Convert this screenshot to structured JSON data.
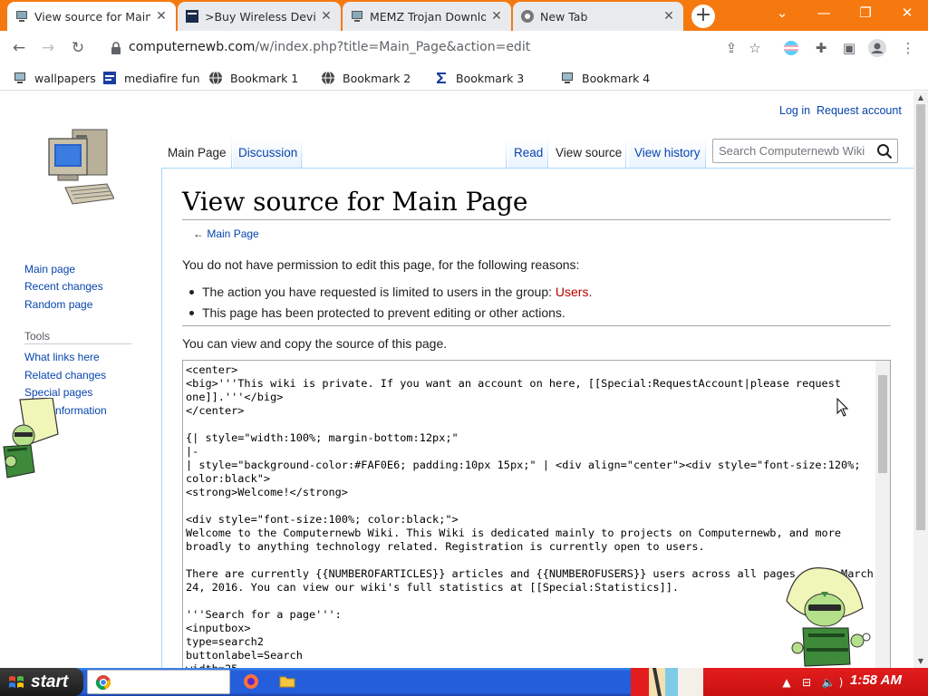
{
  "browser": {
    "tabs": [
      {
        "title": "View source for Main",
        "favicon": "computer-favicon",
        "active": true
      },
      {
        "title": ">Buy Wireless Device",
        "favicon": "site-favicon",
        "active": false
      },
      {
        "title": "MEMZ Trojan Downlo",
        "favicon": "computer-favicon",
        "active": false
      },
      {
        "title": "New Tab",
        "favicon": "chrome-favicon",
        "active": false
      }
    ],
    "new_tab_symbol": "+",
    "url_host": "computernewb.com",
    "url_path": "/w/index.php?title=Main_Page&action=edit",
    "bookmarks": [
      {
        "label": "wallpapers",
        "icon": "computer-icon"
      },
      {
        "label": "mediafire fun",
        "icon": "mediafire-icon"
      },
      {
        "label": "Bookmark 1",
        "icon": "globe-icon"
      },
      {
        "label": "Bookmark 2",
        "icon": "globe-icon"
      },
      {
        "label": "Bookmark 3",
        "icon": "sigma-icon"
      },
      {
        "label": "Bookmark 4",
        "icon": "computer-icon"
      }
    ],
    "accent_color": "#f5790f"
  },
  "page": {
    "personal": {
      "login": "Log in",
      "request": "Request account"
    },
    "tabs": {
      "main_page": "Main Page",
      "discussion": "Discussion",
      "read": "Read",
      "view_source": "View source",
      "view_history": "View history"
    },
    "search_placeholder": "Search Computernewb Wiki",
    "sidebar": {
      "nav": [
        "Main page",
        "Recent changes",
        "Random page"
      ],
      "tools_heading": "Tools",
      "tools": [
        "What links here",
        "Related changes",
        "Special pages",
        "Page information"
      ]
    },
    "heading": "View source for Main Page",
    "back_arrow": "←",
    "back_link": "Main Page",
    "permission_text": "You do not have permission to edit this page, for the following reasons:",
    "reason1_prefix": "The action you have requested is limited to users in the group: ",
    "reason1_link": "Users",
    "reason1_suffix": ".",
    "reason2": "This page has been protected to prevent editing or other actions.",
    "view_copy_text": "You can view and copy the source of this page.",
    "source": "<center>\n<big>'''This wiki is private. If you want an account on here, [[Special:RequestAccount|please request\none]].'''</big>\n</center>\n\n{| style=\"width:100%; margin-bottom:12px;\"\n|-\n| style=\"background-color:#FAF0E6; padding:10px 15px;\" | <div align=\"center\"><div style=\"font-size:120%;\ncolor:black\">\n<strong>Welcome!</strong>\n\n<div style=\"font-size:100%; color:black;\">\nWelcome to the Computernewb Wiki. This Wiki is dedicated mainly to projects on Computernewb, and more\nbroadly to anything technology related. Registration is currently open to users.\n\nThere are currently {{NUMBEROFARTICLES}} articles and {{NUMBEROFUSERS}} users across all pages since March\n24, 2016. You can view our wiki's full statistics at [[Special:Statistics]].\n\n'''Search for a page''':\n<inputbox>\ntype=search2\nbuttonlabel=Search\nwidth=25"
  },
  "taskbar": {
    "start_label": "start",
    "clock": "1:58 AM",
    "color": "#245edb",
    "tray_color": "#d41616"
  }
}
